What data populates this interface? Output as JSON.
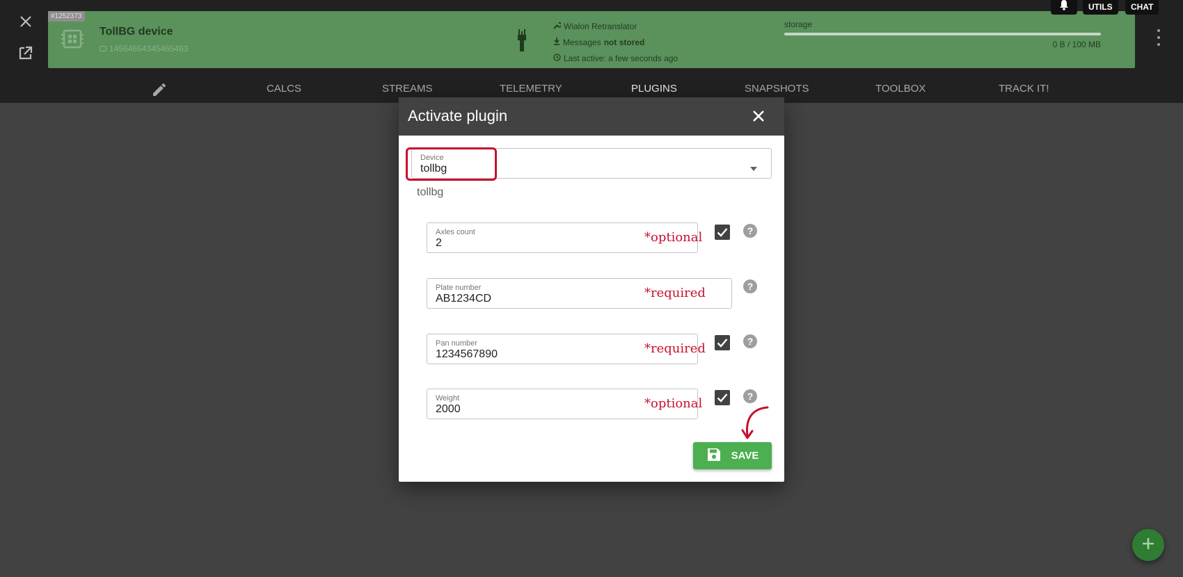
{
  "header": {
    "close_icon": "close-icon",
    "open_external_icon": "open-in-new-icon",
    "device_card": {
      "id_badge": "#1252373",
      "name": "TollBG device",
      "ident": "14564654345465463",
      "channel": "Wialon Retranslator",
      "messages_prefix": "Messages",
      "messages_status": "not stored",
      "last_active": "Last active: a few seconds ago",
      "storage_label": "storage",
      "storage_value": "0 B / 100 MB",
      "storage_fraction": 0.0,
      "background_color": "#5b915b"
    },
    "buttons": {
      "utils": "UTILS",
      "chat": "CHAT"
    }
  },
  "tabs": [
    {
      "label": "CALCS"
    },
    {
      "label": "STREAMS"
    },
    {
      "label": "TELEMETRY"
    },
    {
      "label": "PLUGINS",
      "active": true
    },
    {
      "label": "SNAPSHOTS"
    },
    {
      "label": "TOOLBOX"
    },
    {
      "label": "TRACK IT!"
    }
  ],
  "dialog": {
    "title": "Activate plugin",
    "device_select": {
      "label": "Device",
      "value": "tollbg"
    },
    "device_caption": "tollbg",
    "fields": [
      {
        "label": "Axles count",
        "value": "2",
        "annotation": "*optional",
        "checked": true
      },
      {
        "label": "Plate number",
        "value": "AB1234CD",
        "annotation": "*required"
      },
      {
        "label": "Pan number",
        "value": "1234567890",
        "annotation": "*required",
        "checked": true
      },
      {
        "label": "Weight",
        "value": "2000",
        "annotation": "*optional",
        "checked": true
      }
    ],
    "help_glyph": "?",
    "save_label": "SAVE"
  },
  "colors": {
    "accent_green": "#4caf50",
    "annotation_red": "#c8102e",
    "fab_green": "#2e7d32"
  }
}
